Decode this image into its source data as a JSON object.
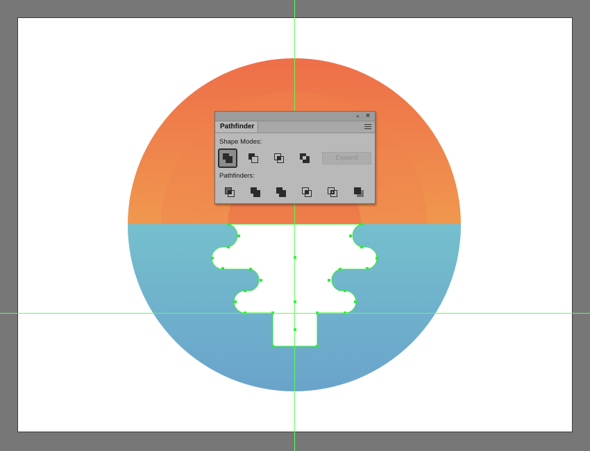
{
  "canvas": {
    "pasteboard_color": "#777777",
    "artboard_color": "#ffffff",
    "guide_color": "#5dff55"
  },
  "artwork": {
    "sun_colors": {
      "outer_top": "#ee6e49",
      "outer_bottom": "#f2c253",
      "mid_top": "#ef7a4a",
      "mid_bottom": "#f0a552",
      "inner": "#ec6e45"
    },
    "water_colors": {
      "top": "#7fdccf",
      "bottom": "#6aa3cb"
    },
    "island_color": "#ffffff",
    "anchor_color": "#32e83c"
  },
  "pathfinder_panel": {
    "title": "Pathfinder",
    "collapse_icon": "«",
    "close_icon": "×",
    "menu_icon": "panel-menu-icon",
    "shape_modes_label": "Shape Modes:",
    "shape_modes": [
      {
        "name": "unite-icon",
        "selected": true
      },
      {
        "name": "minus-front-icon",
        "selected": false
      },
      {
        "name": "intersect-icon",
        "selected": false
      },
      {
        "name": "exclude-icon",
        "selected": false
      }
    ],
    "expand_label": "Expand",
    "pathfinders_label": "Pathfinders:",
    "pathfinders": [
      {
        "name": "divide-icon"
      },
      {
        "name": "trim-icon"
      },
      {
        "name": "merge-icon"
      },
      {
        "name": "crop-icon"
      },
      {
        "name": "outline-icon"
      },
      {
        "name": "minus-back-icon"
      }
    ]
  }
}
